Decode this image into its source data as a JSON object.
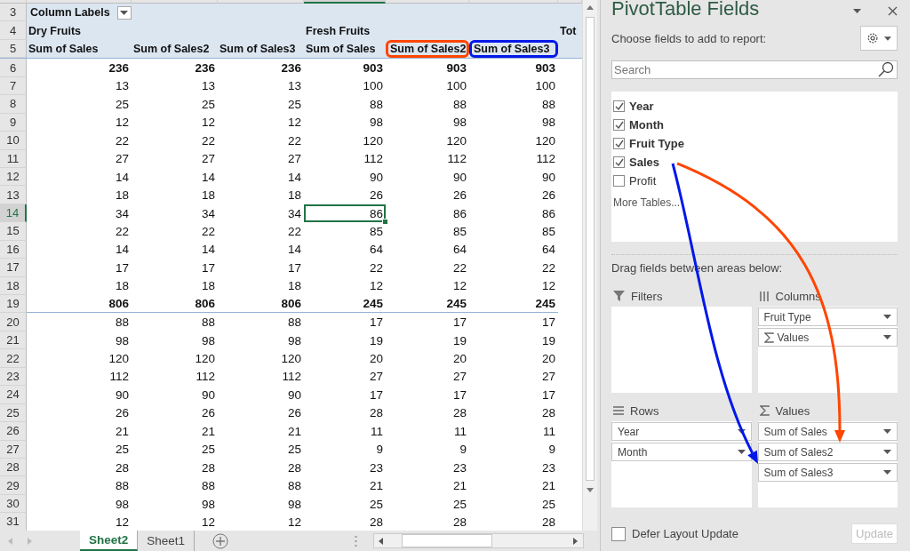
{
  "sheet": {
    "columns": [
      {
        "selected": false
      },
      {
        "selected": false
      },
      {
        "selected": false
      },
      {
        "selected": true
      },
      {
        "selected": false
      },
      {
        "selected": false
      },
      {
        "selected": false
      }
    ],
    "header_rows": [
      {
        "num": "3",
        "label": "Column Labels"
      },
      {
        "num": "4",
        "groups": [
          {
            "text": "Dry Fruits"
          },
          {
            "text": "Fresh Fruits"
          },
          {
            "text": "Tot"
          }
        ]
      },
      {
        "num": "5",
        "headers": [
          {
            "text": "Sum of Sales"
          },
          {
            "text": "Sum of Sales2"
          },
          {
            "text": "Sum of Sales3"
          },
          {
            "text": "Sum of Sales"
          },
          {
            "text": "Sum of Sales2",
            "color": "#ff4500"
          },
          {
            "text": "Sum of Sales3",
            "color": "#0018e8"
          }
        ]
      }
    ],
    "rows": [
      {
        "num": "6",
        "bold": true,
        "selected": false,
        "cells": [
          "236",
          "236",
          "236",
          "903",
          "903",
          "903"
        ]
      },
      {
        "num": "7",
        "bold": false,
        "selected": false,
        "cells": [
          "13",
          "13",
          "13",
          "100",
          "100",
          "100"
        ]
      },
      {
        "num": "8",
        "bold": false,
        "selected": false,
        "cells": [
          "25",
          "25",
          "25",
          "88",
          "88",
          "88"
        ]
      },
      {
        "num": "9",
        "bold": false,
        "selected": false,
        "cells": [
          "12",
          "12",
          "12",
          "98",
          "98",
          "98"
        ]
      },
      {
        "num": "10",
        "bold": false,
        "selected": false,
        "cells": [
          "22",
          "22",
          "22",
          "120",
          "120",
          "120"
        ]
      },
      {
        "num": "11",
        "bold": false,
        "selected": false,
        "cells": [
          "27",
          "27",
          "27",
          "112",
          "112",
          "112"
        ]
      },
      {
        "num": "12",
        "bold": false,
        "selected": false,
        "cells": [
          "14",
          "14",
          "14",
          "90",
          "90",
          "90"
        ]
      },
      {
        "num": "13",
        "bold": false,
        "selected": false,
        "cells": [
          "18",
          "18",
          "18",
          "26",
          "26",
          "26"
        ]
      },
      {
        "num": "14",
        "bold": false,
        "selected": true,
        "cells": [
          "34",
          "34",
          "34",
          "86",
          "86",
          "86"
        ]
      },
      {
        "num": "15",
        "bold": false,
        "selected": false,
        "cells": [
          "22",
          "22",
          "22",
          "85",
          "85",
          "85"
        ]
      },
      {
        "num": "16",
        "bold": false,
        "selected": false,
        "cells": [
          "14",
          "14",
          "14",
          "64",
          "64",
          "64"
        ]
      },
      {
        "num": "17",
        "bold": false,
        "selected": false,
        "cells": [
          "17",
          "17",
          "17",
          "22",
          "22",
          "22"
        ]
      },
      {
        "num": "18",
        "bold": false,
        "selected": false,
        "cells": [
          "18",
          "18",
          "18",
          "12",
          "12",
          "12"
        ]
      },
      {
        "num": "19",
        "bold": true,
        "selected": false,
        "divider_below": true,
        "cells": [
          "806",
          "806",
          "806",
          "245",
          "245",
          "245"
        ]
      },
      {
        "num": "20",
        "bold": false,
        "selected": false,
        "cells": [
          "88",
          "88",
          "88",
          "17",
          "17",
          "17"
        ]
      },
      {
        "num": "21",
        "bold": false,
        "selected": false,
        "cells": [
          "98",
          "98",
          "98",
          "19",
          "19",
          "19"
        ]
      },
      {
        "num": "22",
        "bold": false,
        "selected": false,
        "cells": [
          "120",
          "120",
          "120",
          "20",
          "20",
          "20"
        ]
      },
      {
        "num": "23",
        "bold": false,
        "selected": false,
        "cells": [
          "112",
          "112",
          "112",
          "27",
          "27",
          "27"
        ]
      },
      {
        "num": "24",
        "bold": false,
        "selected": false,
        "cells": [
          "90",
          "90",
          "90",
          "17",
          "17",
          "17"
        ]
      },
      {
        "num": "25",
        "bold": false,
        "selected": false,
        "cells": [
          "26",
          "26",
          "26",
          "28",
          "28",
          "28"
        ]
      },
      {
        "num": "26",
        "bold": false,
        "selected": false,
        "cells": [
          "21",
          "21",
          "21",
          "11",
          "11",
          "11"
        ]
      },
      {
        "num": "27",
        "bold": false,
        "selected": false,
        "cells": [
          "25",
          "25",
          "25",
          "9",
          "9",
          "9"
        ]
      },
      {
        "num": "28",
        "bold": false,
        "selected": false,
        "cells": [
          "28",
          "28",
          "28",
          "23",
          "23",
          "23"
        ]
      },
      {
        "num": "29",
        "bold": false,
        "selected": false,
        "cells": [
          "88",
          "88",
          "88",
          "21",
          "21",
          "21"
        ]
      },
      {
        "num": "30",
        "bold": false,
        "selected": false,
        "cells": [
          "98",
          "98",
          "98",
          "25",
          "25",
          "25"
        ]
      },
      {
        "num": "31",
        "bold": false,
        "selected": false,
        "cells": [
          "12",
          "12",
          "12",
          "28",
          "28",
          "28"
        ]
      }
    ],
    "tabs": [
      {
        "label": "Sheet2",
        "selected": true
      },
      {
        "label": "Sheet1",
        "selected": false
      }
    ]
  },
  "panel": {
    "title": "PivotTable Fields",
    "subtitle": "Choose fields to add to report:",
    "search": {
      "placeholder": "Search"
    },
    "fields": [
      {
        "label": "Year",
        "checked": true
      },
      {
        "label": "Month",
        "checked": true
      },
      {
        "label": "Fruit Type",
        "checked": true
      },
      {
        "label": "Sales",
        "checked": true
      },
      {
        "label": "Profit",
        "checked": false
      }
    ],
    "more_tables": "More Tables...",
    "areas_hint": "Drag fields between areas below:",
    "areas": [
      {
        "kind": "filters",
        "title": "Filters"
      },
      {
        "kind": "columns",
        "title": "Columns",
        "items": [
          {
            "label": "Fruit Type",
            "kind": "field"
          },
          {
            "label": "Values",
            "kind": "values"
          }
        ]
      },
      {
        "kind": "rows",
        "title": "Rows",
        "items": [
          {
            "label": "Year",
            "kind": "field"
          },
          {
            "label": "Month",
            "kind": "field"
          }
        ]
      },
      {
        "kind": "values",
        "title": "Values",
        "items": [
          {
            "label": "Sum of Sales",
            "kind": "field"
          },
          {
            "label": "Sum of Sales2",
            "kind": "field"
          },
          {
            "label": "Sum of Sales3",
            "kind": "field"
          }
        ]
      }
    ],
    "defer": {
      "label": "Defer Layout Update",
      "checked": false
    },
    "update": {
      "label": "Update",
      "disabled": true
    }
  },
  "arrows": [
    {
      "color": "#ff4500"
    },
    {
      "color": "#0018e8"
    }
  ]
}
